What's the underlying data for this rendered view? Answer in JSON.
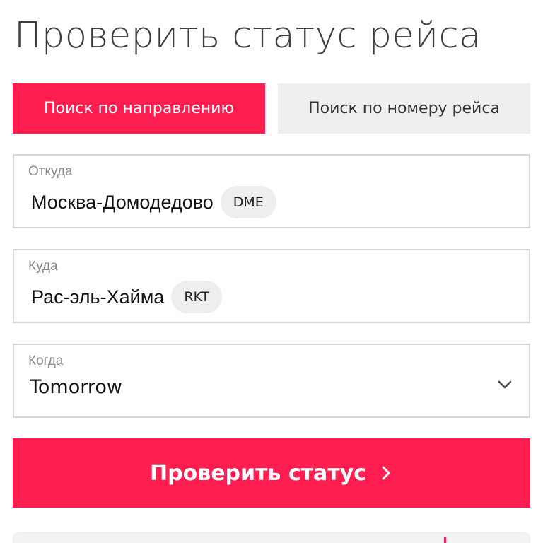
{
  "page": {
    "title": "Проверить статус рейса"
  },
  "tabs": [
    {
      "label": "Поиск по направлению",
      "active": true
    },
    {
      "label": "Поиск по номеру рейса",
      "active": false
    }
  ],
  "form": {
    "from": {
      "label": "Откуда",
      "value": "Москва-Домодедово",
      "code": "DME"
    },
    "to": {
      "label": "Куда",
      "value": "Рас-эль-Хайма",
      "code": "RKT"
    },
    "when": {
      "label": "Когда",
      "value": "Tomorrow",
      "icon": "chevron-down-icon"
    }
  },
  "submit": {
    "label": "Проверить статус",
    "icon": "chevron-right-icon"
  },
  "colors": {
    "accent": "#ff1e4f",
    "inactive_tab_bg": "#efefef",
    "title_text": "#3a3f44",
    "border": "#d6d6d6",
    "badge_bg": "#eeeeee"
  }
}
